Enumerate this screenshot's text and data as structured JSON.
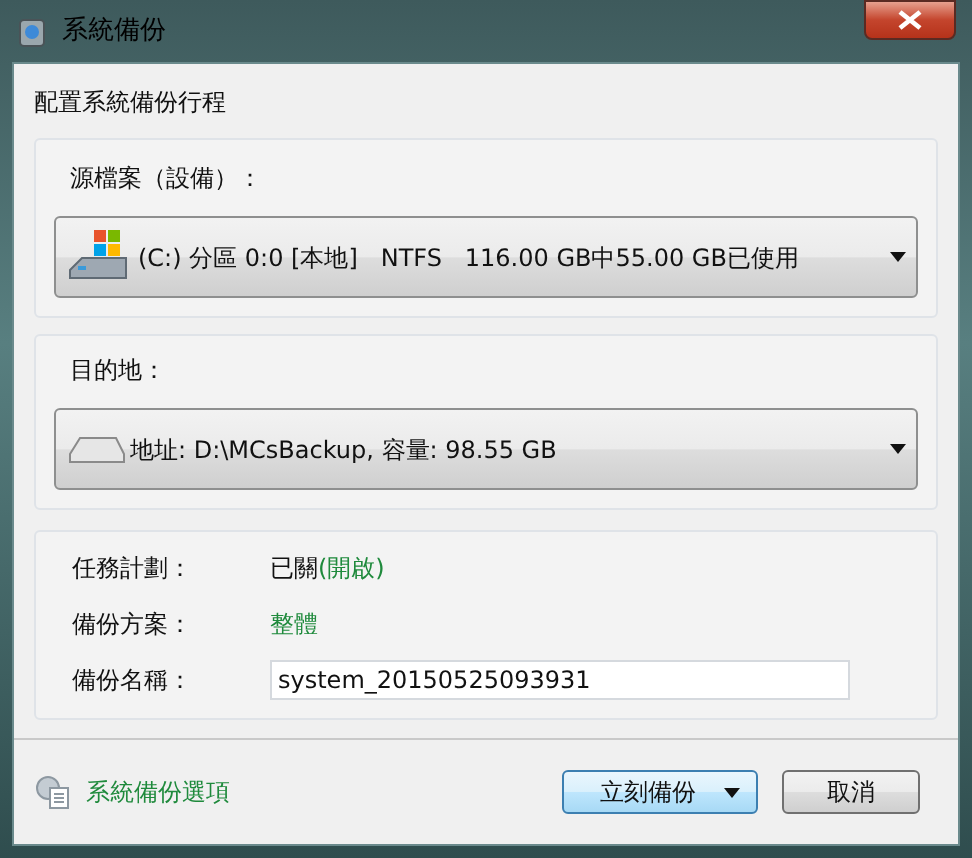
{
  "window": {
    "title": "系統備份"
  },
  "heading": "配置系統備份行程",
  "source": {
    "label": "源檔案（設備）：",
    "value": "(C:) 分區 0:0 [本地]   NTFS   116.00 GB中55.00 GB已使用"
  },
  "destination": {
    "label": "目的地：",
    "value": "地址: D:\\MCsBackup, 容量: 98.55 GB"
  },
  "details": [
    {
      "kind": "status",
      "label": "任務計劃：",
      "value": "已關",
      "link": "(開啟)"
    },
    {
      "kind": "option",
      "label": "備份方案：",
      "value": "整體"
    },
    {
      "kind": "field",
      "label": "備份名稱：",
      "value": "system_20150525093931"
    }
  ],
  "footer": {
    "options_link": "系統備份選項",
    "primary_button": "立刻備份",
    "cancel_button": "取消"
  }
}
